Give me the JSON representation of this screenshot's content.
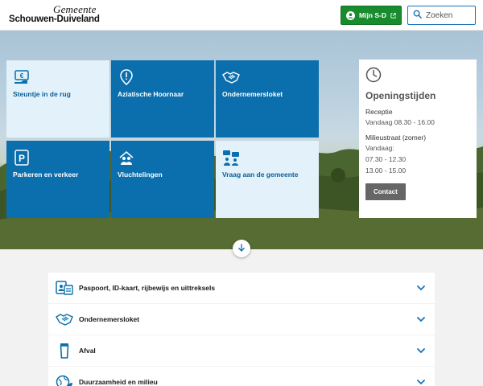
{
  "header": {
    "logo_line1": "Gemeente",
    "logo_line2": "Schouwen-Duiveland",
    "login_label": "Mijn S-D",
    "search_placeholder": "Zoeken",
    "login_color": "#188b2e"
  },
  "tiles": [
    {
      "label": "Steuntje in de rug",
      "icon": "euro-hand-icon",
      "style": "light"
    },
    {
      "label": "Aziatische Hoornaar",
      "icon": "map-alert-icon",
      "style": "dark"
    },
    {
      "label": "Ondernemersloket",
      "icon": "handshake-icon",
      "style": "dark"
    },
    {
      "label": "Parkeren en verkeer",
      "icon": "parking-icon",
      "style": "dark"
    },
    {
      "label": "Vluchtelingen",
      "icon": "people-house-icon",
      "style": "dark"
    },
    {
      "label": "Vraag aan de gemeente",
      "icon": "chat-people-icon",
      "style": "light"
    }
  ],
  "hours": {
    "title": "Openingstijden",
    "reception_label": "Receptie",
    "reception_time": "Vandaag 08.30 - 16.00",
    "milieu_label": "Milieustraat (zomer)",
    "milieu_today": "Vandaag:",
    "milieu_time1": "07.30 - 12.30",
    "milieu_time2": "13.00 - 15.00",
    "contact_label": "Contact"
  },
  "accordion": [
    {
      "label": "Paspoort, ID-kaart, rijbewijs en uittreksels",
      "icon": "id-card-icon"
    },
    {
      "label": "Ondernemersloket",
      "icon": "handshake-icon"
    },
    {
      "label": "Afval",
      "icon": "bin-icon"
    },
    {
      "label": "Duurzaamheid en milieu",
      "icon": "globe-leaf-icon"
    }
  ],
  "colors": {
    "tile_dark": "#0b6fad",
    "tile_light": "#e2f1fa",
    "accent_blue": "#1a72b8"
  }
}
